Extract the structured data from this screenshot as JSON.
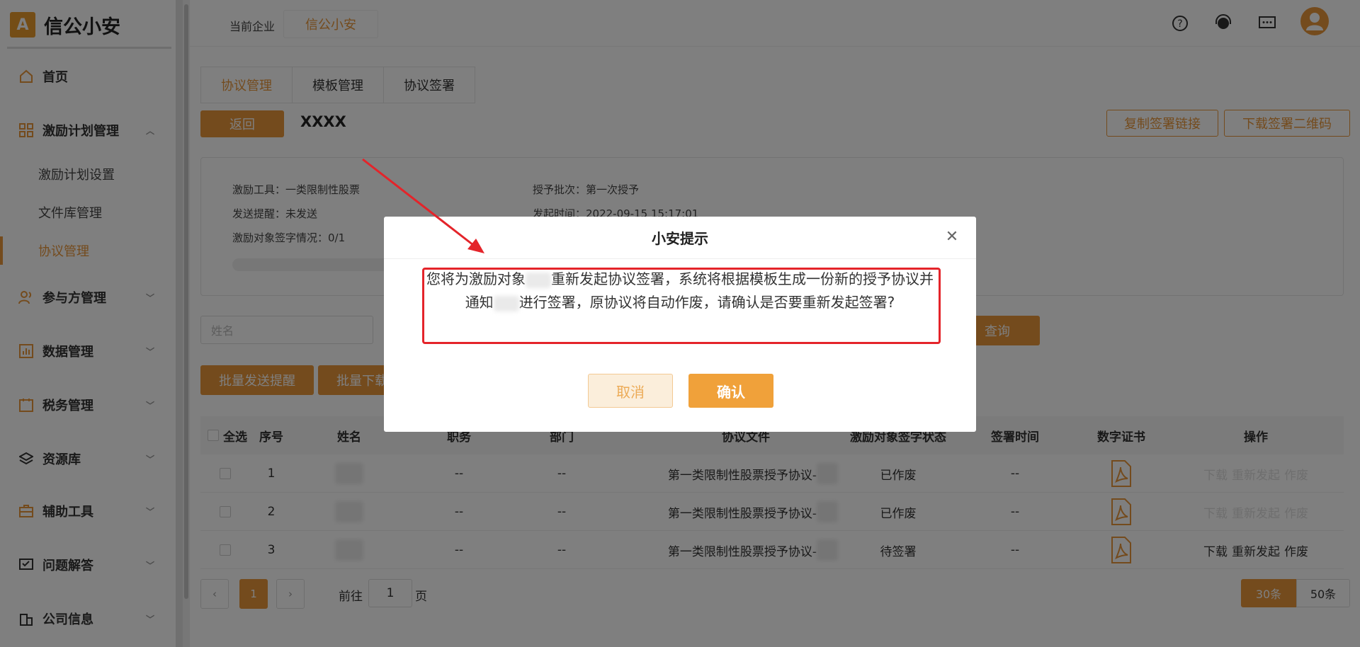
{
  "brand": {
    "name": "信公小安",
    "mark": "A"
  },
  "sidebar": {
    "home": "首页",
    "incentive_group": "激励计划管理",
    "incentive_items": [
      "激励计划设置",
      "文件库管理",
      "协议管理"
    ],
    "groups": [
      "参与方管理",
      "数据管理",
      "税务管理",
      "资源库",
      "辅助工具",
      "问题解答",
      "公司信息"
    ]
  },
  "topbar": {
    "company_label": "当前企业",
    "company_name": "信公小安"
  },
  "tabs": [
    "协议管理",
    "模板管理",
    "协议签署"
  ],
  "header": {
    "back": "返回",
    "title": "XXXX",
    "copy_link": "复制签署链接",
    "download_qr": "下载签署二维码"
  },
  "info": {
    "tool": "激励工具：一类限制性股票",
    "batch": "授予批次：第一次授予",
    "reminder": "发送提醒：未发送",
    "start_time": "发起时间：2022-09-15 15:17:01",
    "sign_status": "激励对象签字情况：0/1"
  },
  "filter": {
    "name_placeholder": "姓名",
    "query": "查询"
  },
  "actions": {
    "batch_remind": "批量发送提醒",
    "batch_download": "批量下载"
  },
  "table": {
    "headers": {
      "select_all": "全选",
      "no": "序号",
      "name": "姓名",
      "position": "职务",
      "dept": "部门",
      "file": "协议文件",
      "status": "激励对象签字状态",
      "time": "签署时间",
      "cert": "数字证书",
      "ops": "操作"
    },
    "rows": [
      {
        "no": "1",
        "position": "--",
        "dept": "--",
        "file": "第一类限制性股票授予协议-",
        "status": "已作废",
        "time": "--"
      },
      {
        "no": "2",
        "position": "--",
        "dept": "--",
        "file": "第一类限制性股票授予协议-",
        "status": "已作废",
        "time": "--"
      },
      {
        "no": "3",
        "position": "--",
        "dept": "--",
        "file": "第一类限制性股票授予协议-",
        "status": "待签署",
        "time": "--"
      }
    ],
    "ops": {
      "download": "下载",
      "resend": "重新发起",
      "void": "作废"
    }
  },
  "pager": {
    "current": "1",
    "goto_prefix": "前往",
    "goto_value": "1",
    "goto_suffix": "页",
    "size_a": "30条",
    "size_b": "50条"
  },
  "dialog": {
    "title": "小安提示",
    "message_1": "您将为激励对象",
    "message_2": "重新发起协议签署，系统将根据模板生成一份新的授予协议并通知",
    "message_3": "进行签署，原协议将自动作废，请确认是否要重新发起签署?",
    "cancel": "取消",
    "confirm": "确认"
  },
  "colors": {
    "accent": "#e8963b",
    "annotation": "#e4242a"
  }
}
